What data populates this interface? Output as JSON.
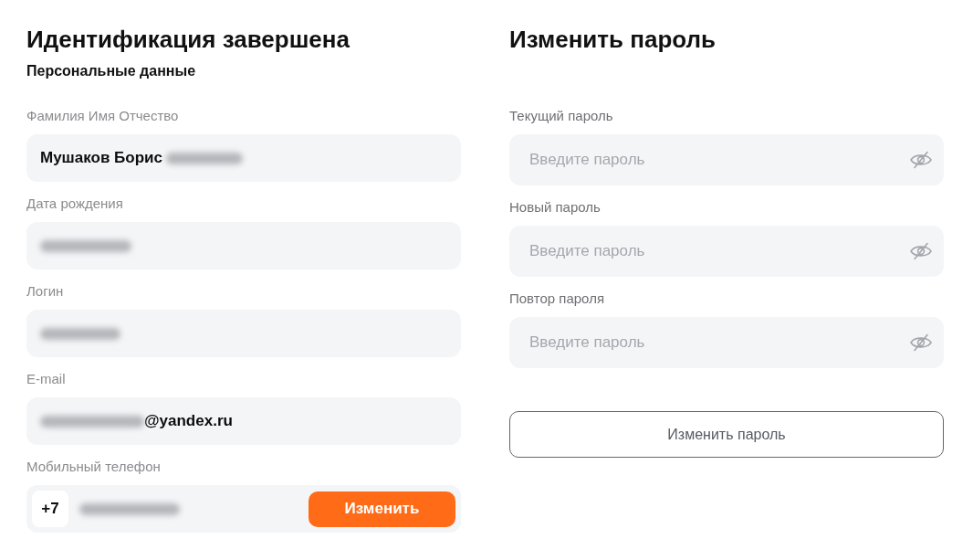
{
  "personal": {
    "title": "Идентификация завершена",
    "subtitle": "Персональные данные",
    "fields": [
      {
        "kind": "text",
        "label": "Фамилия Имя Отчество",
        "parts": [
          {
            "kind": "text",
            "text": "Мушаков Борис"
          },
          {
            "kind": "blurred"
          }
        ]
      },
      {
        "kind": "text",
        "label": "Дата рождения",
        "parts": [
          {
            "kind": "blurred"
          }
        ]
      },
      {
        "kind": "text",
        "label": "Логин",
        "parts": [
          {
            "kind": "blurred"
          }
        ]
      },
      {
        "kind": "text",
        "label": "E-mail",
        "parts": [
          {
            "kind": "blurred"
          },
          {
            "kind": "text",
            "text": "@yandex.ru"
          }
        ]
      },
      {
        "kind": "phone",
        "label": "Мобильный телефон",
        "country_code": "+7",
        "parts": [
          {
            "kind": "blurred"
          }
        ],
        "button": "Изменить"
      }
    ]
  },
  "password": {
    "title": "Изменить пароль",
    "fields": [
      {
        "label": "Текущий пароль",
        "placeholder": "Введите пароль",
        "visible": false
      },
      {
        "label": "Новый пароль",
        "placeholder": "Введите пароль",
        "visible": false
      },
      {
        "label": "Повтор пароля",
        "placeholder": "Введите пароль",
        "visible": false
      }
    ],
    "button": "Изменить пароль"
  }
}
